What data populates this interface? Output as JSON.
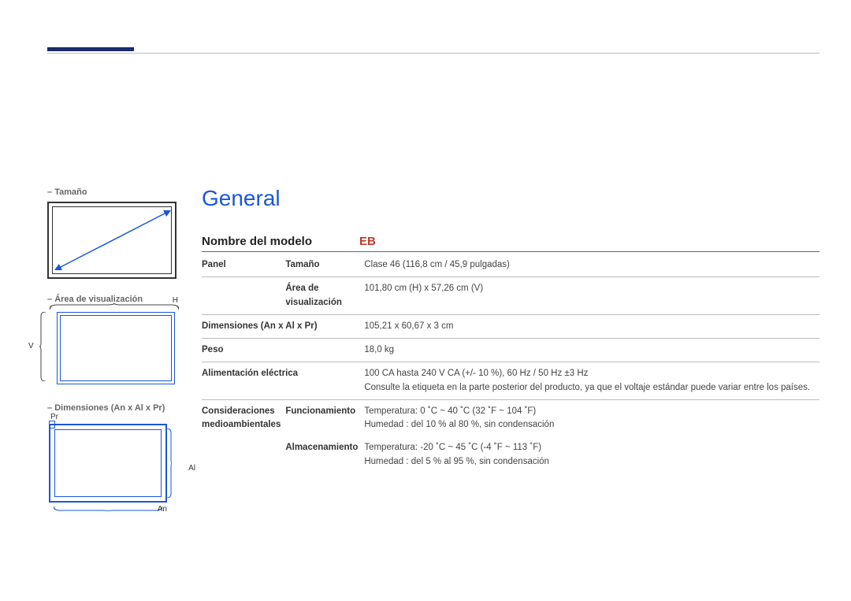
{
  "left": {
    "label_tamano": "Tamaño",
    "label_area": "Área de visualización",
    "label_dim": "Dimensiones (An x Al x Pr)",
    "lab_H": "H",
    "lab_V": "V",
    "lab_Pr": "Pr",
    "lab_Al": "Al",
    "lab_An": "An"
  },
  "content": {
    "title": "General",
    "model_label": "Nombre del modelo",
    "model_value": "EB",
    "rows": {
      "panel": "Panel",
      "tamano": "Tamaño",
      "tamano_val": "Clase 46 (116,8 cm / 45,9 pulgadas)",
      "area": "Área de visualización",
      "area_val": "101,80 cm (H) x 57,26 cm (V)",
      "dim": "Dimensiones (An x Al x Pr)",
      "dim_val": "105,21 x 60,67 x 3 cm",
      "peso": "Peso",
      "peso_val": "18,0 kg",
      "power": "Alimentación eléctrica",
      "power_val": "100 CA hasta 240 V CA (+/- 10 %), 60 Hz / 50 Hz ±3 Hz",
      "power_note": "Consulte la etiqueta en la parte posterior del producto, ya que el voltaje estándar puede variar entre los países.",
      "env": "Consideraciones medioambientales",
      "func": "Funcionamiento",
      "func_temp": "Temperatura: 0  ˚C ~ 40  ˚C (32  ˚F ~ 104  ˚F)",
      "func_hum": "Humedad : del 10 % al 80 %, sin condensación",
      "store": "Almacenamiento",
      "store_temp": "Temperatura: -20  ˚C ~ 45  ˚C (-4  ˚F ~ 113  ˚F)",
      "store_hum": "Humedad : del 5 % al 95 %, sin condensación"
    }
  }
}
